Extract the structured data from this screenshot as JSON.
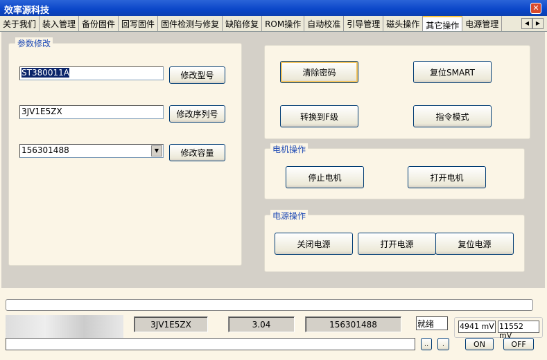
{
  "window": {
    "title": "效率源科技",
    "close": "✕"
  },
  "tabs": [
    "关于我们",
    "装入管理",
    "备份固件",
    "回写固件",
    "固件检测与修复",
    "缺陷修复",
    "ROM操作",
    "自动校准",
    "引导管理",
    "磁头操作",
    "其它操作",
    "电源管理"
  ],
  "active_tab": "其它操作",
  "params": {
    "legend": "参数修改",
    "model": "ST380011A",
    "model_btn": "修改型号",
    "serial": "3JV1E5ZX",
    "serial_btn": "修改序列号",
    "capacity": "156301488",
    "capacity_btn": "修改容量"
  },
  "misc": {
    "clear_pwd": "清除密码",
    "reset_smart": "复位SMART",
    "to_f": "转换到F级",
    "cmd_mode": "指令模式"
  },
  "motor": {
    "legend": "电机操作",
    "stop": "停止电机",
    "start": "打开电机"
  },
  "power": {
    "legend": "电源操作",
    "off": "关闭电源",
    "on": "打开电源",
    "reset": "复位电源"
  },
  "status": {
    "serial": "3JV1E5ZX",
    "firmware": "3.04",
    "lba": "156301488",
    "state": "就绪",
    "v5": "4941 mV",
    "v12": "11552 mV",
    "btn1": "..",
    "btn2": ".",
    "on": "ON",
    "off": "OFF"
  },
  "progress": 0
}
